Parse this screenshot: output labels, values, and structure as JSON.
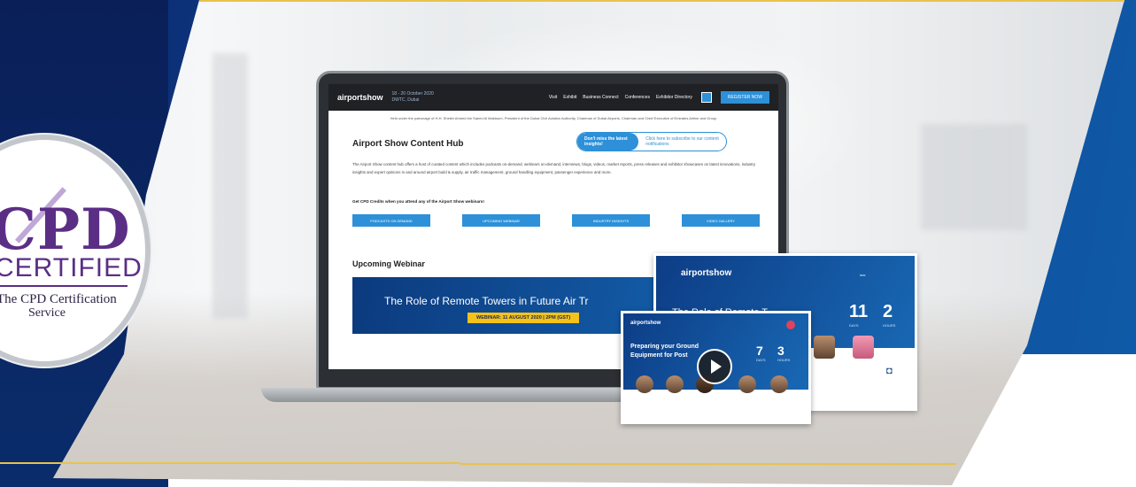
{
  "badge": {
    "mark": "CPD",
    "certified": "CERTIFIED",
    "service_line1": "The CPD Certification",
    "service_line2": "Service"
  },
  "screen": {
    "nav": {
      "logo": "airportshow",
      "date_line1": "18 - 20 October 2020",
      "date_line2": "DWTC, Dubai",
      "links": [
        "Visit",
        "Exhibit",
        "Business Connect",
        "Conferences",
        "Exhibitor Directory"
      ],
      "register_label": "REGISTER NOW"
    },
    "patron": "Held under the patronage of H.H. Sheikh Ahmed bin Saeed Al Maktoum, President of the Dubai Civil Aviation Authority, Chairman of Dubai Airports, Chairman and Chief Executive of Emirates Airline and Group",
    "hub_title": "Airport Show Content Hub",
    "pill_left": "Don't miss the latest insights!",
    "pill_right": "Click here to subscribe to our content notifications",
    "hub_desc": "The Airport Show content hub offers a host of curated content which includes podcasts on-demand, webinars on-demand, interviews, blogs, videos, market reports, press releases and exhibitor showcases on latest innovations, industry insights and expert opinions in and around airport build & supply, air traffic management, ground handling equipment, passenger experience and more.",
    "cpd_line": "Get CPD Credits when you attend any of the Airport Show webinars!",
    "buttons": [
      "PODCASTS ON DEMAND",
      "UPCOMING WEBINAR",
      "INDUSTRY INSIGHTS",
      "VIDEO GALLERY"
    ],
    "upcoming": "Upcoming Webinar",
    "banner_title": "The Role of Remote Towers in Future Air Tr",
    "banner_sub": "WEBINAR: 11 AUGUST 2020 | 2PM (GST)"
  },
  "card_back": {
    "logo": "airportshow",
    "title": "The Role of Remote T",
    "days": "11",
    "days_label": "DAYS",
    "hours": "2",
    "hours_label": "HOURS"
  },
  "card_front": {
    "logo": "airportshow",
    "title_line1": "Preparing your Ground",
    "title_line2": "Equipment for Post",
    "days": "7",
    "days_label": "DAYS",
    "hours": "3",
    "hours_label": "HOURS"
  },
  "colors": {
    "brand_blue": "#2d90d8",
    "navy": "#0d3a86",
    "gold": "#e8c34a",
    "cpd_purple": "#5b2e86"
  }
}
